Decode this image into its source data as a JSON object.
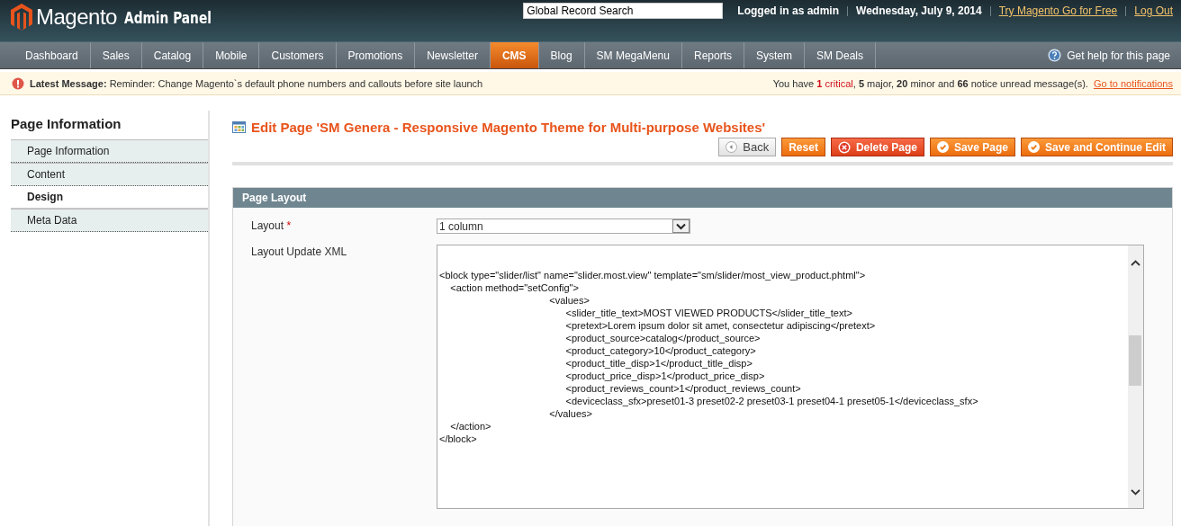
{
  "header": {
    "brand": "Magento",
    "brand_suffix": "Admin Panel",
    "search": {
      "value": "Global Record Search"
    },
    "user": "Logged in as admin",
    "date": "Wednesday, July 9, 2014",
    "links": [
      "Try Magento Go for Free",
      "Log Out"
    ]
  },
  "nav": {
    "items": [
      {
        "label": "Dashboard",
        "selected": false
      },
      {
        "label": "Sales",
        "selected": false
      },
      {
        "label": "Catalog",
        "selected": false
      },
      {
        "label": "Mobile",
        "selected": false
      },
      {
        "label": "Customers",
        "selected": false
      },
      {
        "label": "Promotions",
        "selected": false
      },
      {
        "label": "Newsletter",
        "selected": false
      },
      {
        "label": "CMS",
        "selected": true
      },
      {
        "label": "Blog",
        "selected": false
      },
      {
        "label": "SM MegaMenu",
        "selected": false
      },
      {
        "label": "Reports",
        "selected": false
      },
      {
        "label": "System",
        "selected": false
      },
      {
        "label": "SM Deals",
        "selected": false
      }
    ],
    "help": "Get help for this page"
  },
  "message_bar": {
    "message": "**Latest Message:** Reminder: Change Magento`s default phone numbers and callouts before site launch",
    "summary": [
      {
        "kind": "plain",
        "text": "You have "
      },
      {
        "kind": "critical-count",
        "text": "1"
      },
      {
        "kind": "critical",
        "text": "critical"
      },
      {
        "kind": "plain",
        "text": ", "
      },
      {
        "kind": "count",
        "text": "5"
      },
      {
        "kind": "plain",
        "text": " major, "
      },
      {
        "kind": "count",
        "text": "20"
      },
      {
        "kind": "plain",
        "text": " minor and "
      },
      {
        "kind": "count",
        "text": "66"
      },
      {
        "kind": "plain",
        "text": " notice unread message(s)."
      }
    ],
    "link": "Go to notifications"
  },
  "sidebar": {
    "title": "Page Information",
    "items": [
      {
        "label": "Page Information",
        "selected": false
      },
      {
        "label": "Content",
        "selected": false
      },
      {
        "label": "Design",
        "selected": true
      },
      {
        "label": "Meta Data",
        "selected": false
      }
    ]
  },
  "page": {
    "title": "Edit Page 'SM Genera - Responsive Magento Theme for Multi-purpose Websites'",
    "buttons": [
      {
        "label": "Back",
        "kind": "back"
      },
      {
        "label": "Reset",
        "kind": "plain"
      },
      {
        "label": "Delete Page",
        "kind": "delete"
      },
      {
        "label": "Save Page",
        "kind": "save"
      },
      {
        "label": "Save and Continue Edit",
        "kind": "save"
      }
    ]
  },
  "section": {
    "title": "Page Layout",
    "layout_label": "Layout",
    "required_mark": "*",
    "layout_value": "1 column",
    "xml_label": "Layout Update XML",
    "xml_value": "\n<block type=\"slider/list\" name=\"slider.most.view\" template=\"sm/slider/most_view_product.phtml\">\n    <action method=\"setConfig\">\n                                        <values>\n                                              <slider_title_text>MOST VIEWED PRODUCTS</slider_title_text>\n                                              <pretext>Lorem ipsum dolor sit amet, consectetur adipiscing</pretext>\n                                              <product_source>catalog</product_source>\n                                              <product_category>10</product_category>\n                                              <product_title_disp>1</product_title_disp>\n                                              <product_price_disp>1</product_price_disp>\n                                              <product_reviews_count>1</product_reviews_count>\n                                              <deviceclass_sfx>preset01-3 preset02-2 preset03-1 preset04-1 preset05-1</deviceclass_sfx>\n                                        </values>\n    </action>\n</block>"
  }
}
